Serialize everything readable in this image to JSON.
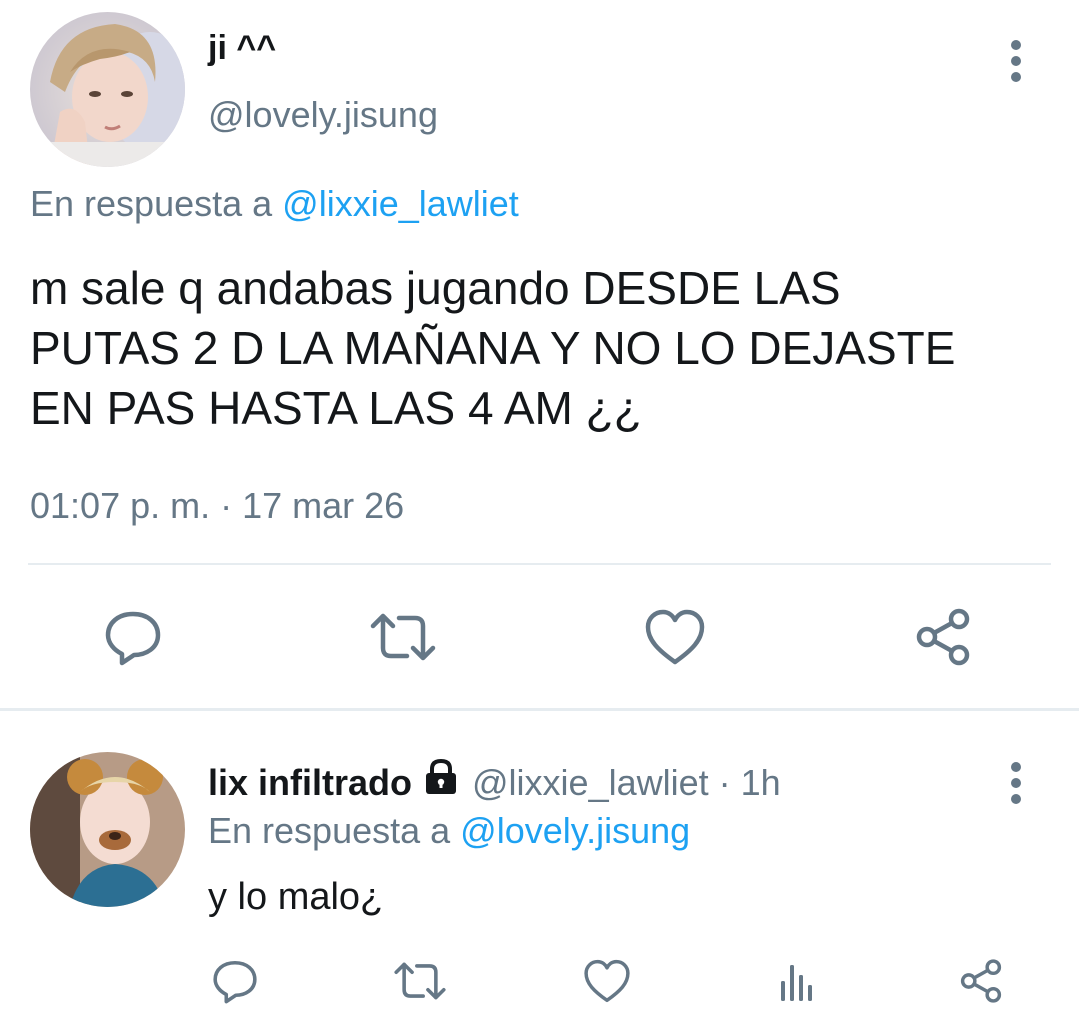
{
  "tweet": {
    "display_name": "ji ^^",
    "handle": "@lovely.jisung",
    "reply_prefix": "En respuesta a",
    "reply_to": "@lixxie_lawliet",
    "text_line1": "m sale q andabas jugando DESDE LAS",
    "text_line2": "PUTAS 2 D LA MAÑANA Y NO LO DEJASTE",
    "text_line3": "EN PAS HASTA LAS 4 AM ¿¿",
    "timestamp": "01:07 p. m. · 17 mar 26",
    "avatar_icon": "avatar",
    "more_icon": "more-vertical-icon"
  },
  "actions": {
    "reply_icon": "reply-icon",
    "retweet_icon": "retweet-icon",
    "like_icon": "heart-icon",
    "share_icon": "share-icon"
  },
  "reply": {
    "display_name": "lix infiltrado",
    "lock_icon": "lock-icon",
    "handle": "@lixxie_lawliet",
    "time": "· 1h",
    "reply_prefix": "En respuesta a",
    "reply_to": "@lovely.jisung",
    "text": "y lo malo¿",
    "actions": [
      "reply-icon",
      "retweet-icon",
      "heart-icon",
      "analytics-icon",
      "share-icon"
    ]
  },
  "colors": {
    "link": "#1da1f2",
    "muted": "#657786",
    "text": "#14171a",
    "divider": "#e6ecf0"
  }
}
